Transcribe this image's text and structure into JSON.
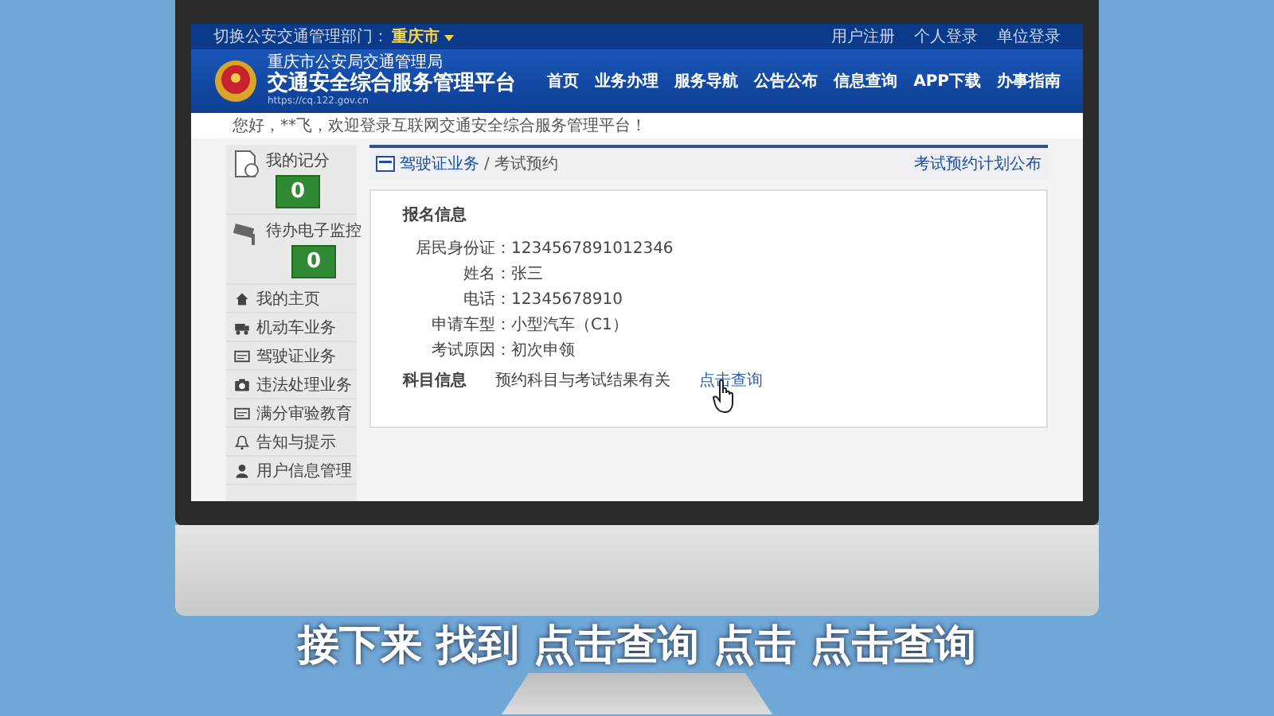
{
  "topbar": {
    "dept_label": "切换公安交通管理部门：",
    "dept_value": "重庆市",
    "links": [
      "用户注册",
      "个人登录",
      "单位登录"
    ]
  },
  "header": {
    "org": "重庆市公安局交通管理局",
    "title": "交通安全综合服务管理平台",
    "url": "https://cq.122.gov.cn",
    "nav": [
      "首页",
      "业务办理",
      "服务导航",
      "公告公布",
      "信息查询",
      "APP下载",
      "办事指南"
    ]
  },
  "welcome": "您好，**飞，欢迎登录互联网交通安全综合服务管理平台！",
  "sidebar": {
    "scores": [
      {
        "label": "我的记分",
        "value": "0"
      },
      {
        "label": "待办电子监控",
        "value": "0"
      }
    ],
    "items": [
      "我的主页",
      "机动车业务",
      "驾驶证业务",
      "违法处理业务",
      "满分审验教育",
      "告知与提示",
      "用户信息管理"
    ]
  },
  "breadcrumb": {
    "section": "驾驶证业务",
    "separator": "/",
    "page": "考试预约",
    "link": "考试预约计划公布"
  },
  "form": {
    "heading": "报名信息",
    "fields": [
      {
        "label": "居民身份证：",
        "value": "1234567891012346"
      },
      {
        "label": "姓名：",
        "value": "张三"
      },
      {
        "label": "电话：",
        "value": "12345678910"
      },
      {
        "label": "申请车型：",
        "value": "小型汽车（C1）"
      },
      {
        "label": "考试原因：",
        "value": "初次申领"
      }
    ],
    "subject": {
      "label": "科目信息",
      "text": "预约科目与考试结果有关",
      "link": "点击查询"
    }
  },
  "subtitle": "接下来 找到 点击查询 点击 点击查询"
}
